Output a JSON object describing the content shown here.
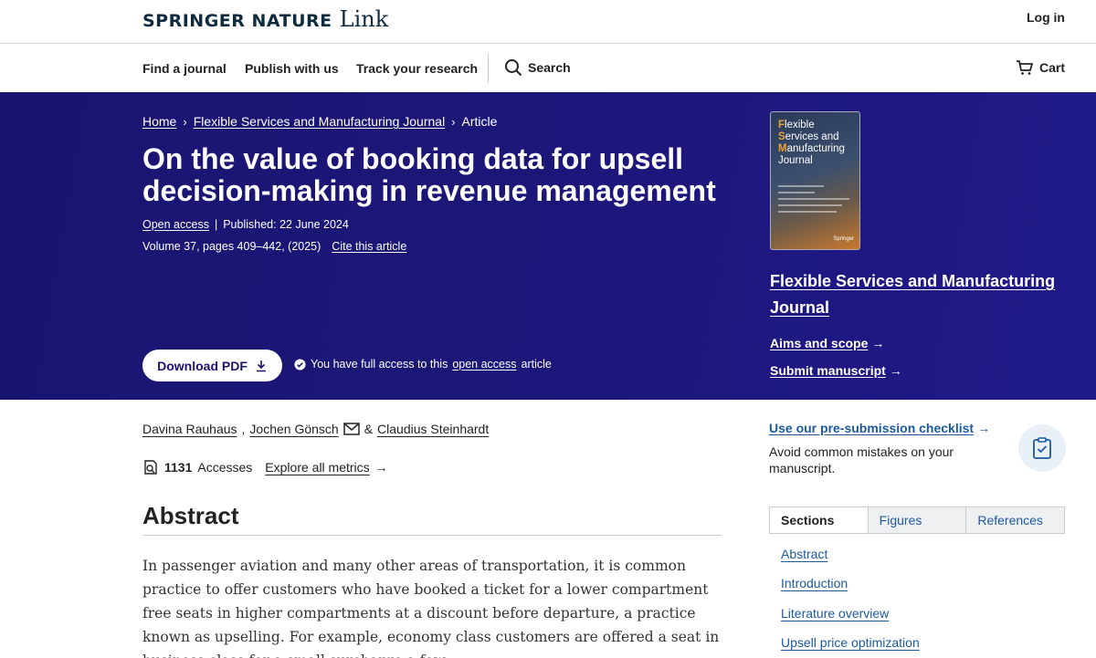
{
  "header": {
    "brand": "SPRINGER NATURE",
    "product": "Link",
    "login": "Log in"
  },
  "nav": {
    "items": [
      "Find a journal",
      "Publish with us",
      "Track your research"
    ],
    "search": "Search",
    "cart": "Cart"
  },
  "breadcrumb": [
    "Home",
    "Flexible Services and Manufacturing Journal",
    "Article"
  ],
  "article": {
    "title": "On the value of booking data for upsell decision-making in revenue management",
    "open_access": "Open access",
    "published": "Published: 22 June 2024",
    "volume": "Volume 37, pages 409–442, (2025)",
    "cite": "Cite this article"
  },
  "download": {
    "label": "Download PDF",
    "access_pre": "You have full access to this",
    "access_link": "open access",
    "access_post": "article"
  },
  "cover": {
    "line1_cap": "F",
    "line1": "lexible",
    "line2_cap": "S",
    "line2": "ervices and",
    "line3_cap": "M",
    "line3": "anufacturing",
    "line4": "Journal",
    "publisher": "Springer"
  },
  "journal": {
    "name": "Flexible Services and Manufacturing Journal",
    "aims": "Aims and scope",
    "submit": "Submit manuscript"
  },
  "authors": [
    "Davina Rauhaus",
    "Jochen Gönsch",
    "Claudius Steinhardt"
  ],
  "author_sep1": ",",
  "author_sep2": "&",
  "metrics": {
    "accesses_count": "1131",
    "accesses_label": "Accesses",
    "explore": "Explore all metrics"
  },
  "abstract": {
    "heading": "Abstract",
    "text": "In passenger aviation and many other areas of transportation, it is common practice to offer customers who have booked a ticket for a lower compartment free seats in higher compartments at a discount before departure, a practice known as upselling. For example, economy class customers are offered a seat in business class for a small surcharge a few"
  },
  "checklist": {
    "link": "Use our pre-submission checklist",
    "desc": "Avoid common mistakes on your manuscript."
  },
  "tabs": [
    "Sections",
    "Figures",
    "References"
  ],
  "toc": [
    "Abstract",
    "Introduction",
    "Literature overview",
    "Upsell price optimization"
  ]
}
